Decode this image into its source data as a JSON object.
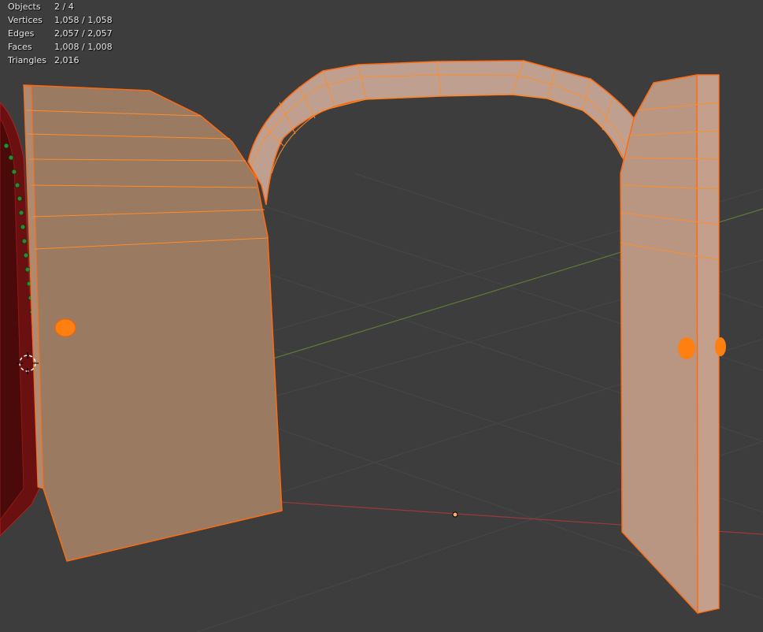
{
  "viewport": {
    "overlay_stats": [
      {
        "label": "Objects",
        "value": "2 / 4"
      },
      {
        "label": "Vertices",
        "value": "1,058 / 1,058"
      },
      {
        "label": "Edges",
        "value": "2,057 / 2,057"
      },
      {
        "label": "Faces",
        "value": "1,008 / 1,008"
      },
      {
        "label": "Triangles",
        "value": "2,016"
      }
    ],
    "colors": {
      "background": "#3d3d3d",
      "grid": "#4a4a4a",
      "x_axis": "#9a3a3a",
      "y_axis": "#5f7a35",
      "selected_face": "#9a7a62",
      "selected_edge": "#ff7a1a",
      "vertex": "#ff8c1a",
      "door_frame": "#7a1414"
    },
    "icons": [
      "3d-cursor-icon",
      "origin-point-icon"
    ]
  }
}
